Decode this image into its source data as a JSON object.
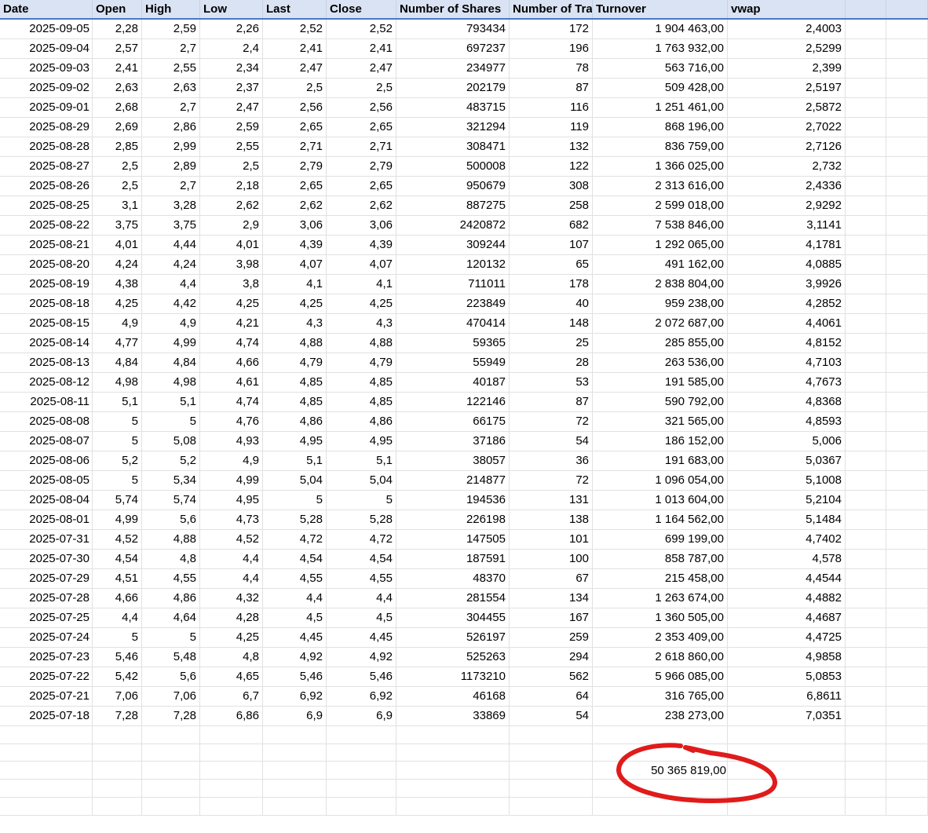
{
  "headers": [
    "Date",
    "Open",
    "High",
    "Low",
    "Last",
    "Close",
    "Number of Shares",
    "Number of Trac",
    "Turnover",
    "vwap",
    "",
    ""
  ],
  "rows": [
    [
      "2025-09-05",
      "2,28",
      "2,59",
      "2,26",
      "2,52",
      "2,52",
      "793434",
      "172",
      "1 904 463,00",
      "2,4003"
    ],
    [
      "2025-09-04",
      "2,57",
      "2,7",
      "2,4",
      "2,41",
      "2,41",
      "697237",
      "196",
      "1 763 932,00",
      "2,5299"
    ],
    [
      "2025-09-03",
      "2,41",
      "2,55",
      "2,34",
      "2,47",
      "2,47",
      "234977",
      "78",
      "563 716,00",
      "2,399"
    ],
    [
      "2025-09-02",
      "2,63",
      "2,63",
      "2,37",
      "2,5",
      "2,5",
      "202179",
      "87",
      "509 428,00",
      "2,5197"
    ],
    [
      "2025-09-01",
      "2,68",
      "2,7",
      "2,47",
      "2,56",
      "2,56",
      "483715",
      "116",
      "1 251 461,00",
      "2,5872"
    ],
    [
      "2025-08-29",
      "2,69",
      "2,86",
      "2,59",
      "2,65",
      "2,65",
      "321294",
      "119",
      "868 196,00",
      "2,7022"
    ],
    [
      "2025-08-28",
      "2,85",
      "2,99",
      "2,55",
      "2,71",
      "2,71",
      "308471",
      "132",
      "836 759,00",
      "2,7126"
    ],
    [
      "2025-08-27",
      "2,5",
      "2,89",
      "2,5",
      "2,79",
      "2,79",
      "500008",
      "122",
      "1 366 025,00",
      "2,732"
    ],
    [
      "2025-08-26",
      "2,5",
      "2,7",
      "2,18",
      "2,65",
      "2,65",
      "950679",
      "308",
      "2 313 616,00",
      "2,4336"
    ],
    [
      "2025-08-25",
      "3,1",
      "3,28",
      "2,62",
      "2,62",
      "2,62",
      "887275",
      "258",
      "2 599 018,00",
      "2,9292"
    ],
    [
      "2025-08-22",
      "3,75",
      "3,75",
      "2,9",
      "3,06",
      "3,06",
      "2420872",
      "682",
      "7 538 846,00",
      "3,1141"
    ],
    [
      "2025-08-21",
      "4,01",
      "4,44",
      "4,01",
      "4,39",
      "4,39",
      "309244",
      "107",
      "1 292 065,00",
      "4,1781"
    ],
    [
      "2025-08-20",
      "4,24",
      "4,24",
      "3,98",
      "4,07",
      "4,07",
      "120132",
      "65",
      "491 162,00",
      "4,0885"
    ],
    [
      "2025-08-19",
      "4,38",
      "4,4",
      "3,8",
      "4,1",
      "4,1",
      "711011",
      "178",
      "2 838 804,00",
      "3,9926"
    ],
    [
      "2025-08-18",
      "4,25",
      "4,42",
      "4,25",
      "4,25",
      "4,25",
      "223849",
      "40",
      "959 238,00",
      "4,2852"
    ],
    [
      "2025-08-15",
      "4,9",
      "4,9",
      "4,21",
      "4,3",
      "4,3",
      "470414",
      "148",
      "2 072 687,00",
      "4,4061"
    ],
    [
      "2025-08-14",
      "4,77",
      "4,99",
      "4,74",
      "4,88",
      "4,88",
      "59365",
      "25",
      "285 855,00",
      "4,8152"
    ],
    [
      "2025-08-13",
      "4,84",
      "4,84",
      "4,66",
      "4,79",
      "4,79",
      "55949",
      "28",
      "263 536,00",
      "4,7103"
    ],
    [
      "2025-08-12",
      "4,98",
      "4,98",
      "4,61",
      "4,85",
      "4,85",
      "40187",
      "53",
      "191 585,00",
      "4,7673"
    ],
    [
      "2025-08-11",
      "5,1",
      "5,1",
      "4,74",
      "4,85",
      "4,85",
      "122146",
      "87",
      "590 792,00",
      "4,8368"
    ],
    [
      "2025-08-08",
      "5",
      "5",
      "4,76",
      "4,86",
      "4,86",
      "66175",
      "72",
      "321 565,00",
      "4,8593"
    ],
    [
      "2025-08-07",
      "5",
      "5,08",
      "4,93",
      "4,95",
      "4,95",
      "37186",
      "54",
      "186 152,00",
      "5,006"
    ],
    [
      "2025-08-06",
      "5,2",
      "5,2",
      "4,9",
      "5,1",
      "5,1",
      "38057",
      "36",
      "191 683,00",
      "5,0367"
    ],
    [
      "2025-08-05",
      "5",
      "5,34",
      "4,99",
      "5,04",
      "5,04",
      "214877",
      "72",
      "1 096 054,00",
      "5,1008"
    ],
    [
      "2025-08-04",
      "5,74",
      "5,74",
      "4,95",
      "5",
      "5",
      "194536",
      "131",
      "1 013 604,00",
      "5,2104"
    ],
    [
      "2025-08-01",
      "4,99",
      "5,6",
      "4,73",
      "5,28",
      "5,28",
      "226198",
      "138",
      "1 164 562,00",
      "5,1484"
    ],
    [
      "2025-07-31",
      "4,52",
      "4,88",
      "4,52",
      "4,72",
      "4,72",
      "147505",
      "101",
      "699 199,00",
      "4,7402"
    ],
    [
      "2025-07-30",
      "4,54",
      "4,8",
      "4,4",
      "4,54",
      "4,54",
      "187591",
      "100",
      "858 787,00",
      "4,578"
    ],
    [
      "2025-07-29",
      "4,51",
      "4,55",
      "4,4",
      "4,55",
      "4,55",
      "48370",
      "67",
      "215 458,00",
      "4,4544"
    ],
    [
      "2025-07-28",
      "4,66",
      "4,86",
      "4,32",
      "4,4",
      "4,4",
      "281554",
      "134",
      "1 263 674,00",
      "4,4882"
    ],
    [
      "2025-07-25",
      "4,4",
      "4,64",
      "4,28",
      "4,5",
      "4,5",
      "304455",
      "167",
      "1 360 505,00",
      "4,4687"
    ],
    [
      "2025-07-24",
      "5",
      "5",
      "4,25",
      "4,45",
      "4,45",
      "526197",
      "259",
      "2 353 409,00",
      "4,4725"
    ],
    [
      "2025-07-23",
      "5,46",
      "5,48",
      "4,8",
      "4,92",
      "4,92",
      "525263",
      "294",
      "2 618 860,00",
      "4,9858"
    ],
    [
      "2025-07-22",
      "5,42",
      "5,6",
      "4,65",
      "5,46",
      "5,46",
      "1173210",
      "562",
      "5 966 085,00",
      "5,0853"
    ],
    [
      "2025-07-21",
      "7,06",
      "7,06",
      "6,7",
      "6,92",
      "6,92",
      "46168",
      "64",
      "316 765,00",
      "6,8611"
    ],
    [
      "2025-07-18",
      "7,28",
      "7,28",
      "6,86",
      "6,9",
      "6,9",
      "33869",
      "54",
      "238 273,00",
      "7,0351"
    ]
  ],
  "turnover_total": "50 365 819,00",
  "empty_rows_after": 5,
  "colors": {
    "header_bg": "#dae3f3",
    "header_border": "#4a78c2",
    "gridline": "#e1e1e1",
    "annotation_circle": "#e01b1b"
  }
}
